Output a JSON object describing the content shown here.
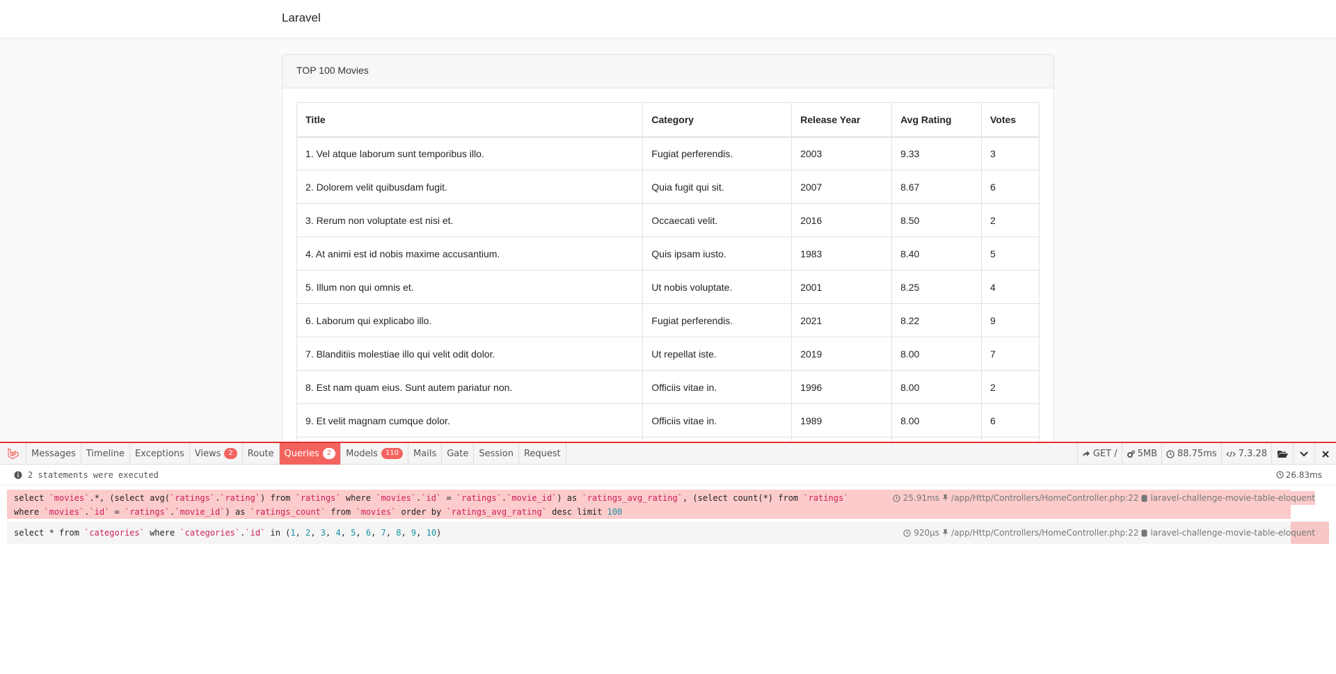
{
  "navbar": {
    "brand": "Laravel"
  },
  "card": {
    "title": "TOP 100 Movies",
    "columns": [
      "Title",
      "Category",
      "Release Year",
      "Avg Rating",
      "Votes"
    ],
    "rows": [
      [
        "1. Vel atque laborum sunt temporibus illo.",
        "Fugiat perferendis.",
        "2003",
        "9.33",
        "3"
      ],
      [
        "2. Dolorem velit quibusdam fugit.",
        "Quia fugit qui sit.",
        "2007",
        "8.67",
        "6"
      ],
      [
        "3. Rerum non voluptate est nisi et.",
        "Occaecati velit.",
        "2016",
        "8.50",
        "2"
      ],
      [
        "4. At animi est id nobis maxime accusantium.",
        "Quis ipsam iusto.",
        "1983",
        "8.40",
        "5"
      ],
      [
        "5. Illum non qui omnis et.",
        "Ut nobis voluptate.",
        "2001",
        "8.25",
        "4"
      ],
      [
        "6. Laborum qui explicabo illo.",
        "Fugiat perferendis.",
        "2021",
        "8.22",
        "9"
      ],
      [
        "7. Blanditiis molestiae illo qui velit odit dolor.",
        "Ut repellat iste.",
        "2019",
        "8.00",
        "7"
      ],
      [
        "8. Est nam quam eius. Sunt autem pariatur non.",
        "Officiis vitae in.",
        "1996",
        "8.00",
        "2"
      ],
      [
        "9. Et velit magnam cumque dolor.",
        "Officiis vitae in.",
        "1989",
        "8.00",
        "6"
      ],
      [
        "",
        "",
        "",
        "",
        ""
      ]
    ]
  },
  "debugbar": {
    "tabs": [
      {
        "label": "Messages",
        "badge": ""
      },
      {
        "label": "Timeline",
        "badge": ""
      },
      {
        "label": "Exceptions",
        "badge": ""
      },
      {
        "label": "Views",
        "badge": "2"
      },
      {
        "label": "Route",
        "badge": ""
      },
      {
        "label": "Queries",
        "badge": "2"
      },
      {
        "label": "Models",
        "badge": "110"
      },
      {
        "label": "Mails",
        "badge": ""
      },
      {
        "label": "Gate",
        "badge": ""
      },
      {
        "label": "Session",
        "badge": ""
      },
      {
        "label": "Request",
        "badge": ""
      }
    ],
    "active_tab": "Queries",
    "indicators": {
      "method": "GET /",
      "memory": "5MB",
      "time": "88.75ms",
      "php": "7.3.28"
    },
    "status": "2 statements were executed",
    "total_time": "26.83ms",
    "queries": [
      {
        "line1": "select `movies`.*, (select avg(`ratings`.`rating`) from `ratings` where `movies`.`id` = `ratings`.`movie_id`) as `ratings_avg_rating`, (select count(*) from `ratings`",
        "line2": "where `movies`.`id` = `ratings`.`movie_id`) as `ratings_count` from `movies` order by `ratings_avg_rating` desc limit 100",
        "duration": "25.91ms",
        "source": "/app/Http/Controllers/HomeController.php:22",
        "connection": "laravel-challenge-movie-table-eloquent"
      },
      {
        "line1": "select * from `categories` where `categories`.`id` in (1, 2, 3, 4, 5, 6, 7, 8, 9, 10)",
        "duration": "920μs",
        "source": "/app/Http/Controllers/HomeController.php:22",
        "connection": "laravel-challenge-movie-table-eloquent"
      }
    ],
    "colors": {
      "accent": "#f4645f",
      "string": "#cc1e5b",
      "number": "#1693a5"
    }
  }
}
